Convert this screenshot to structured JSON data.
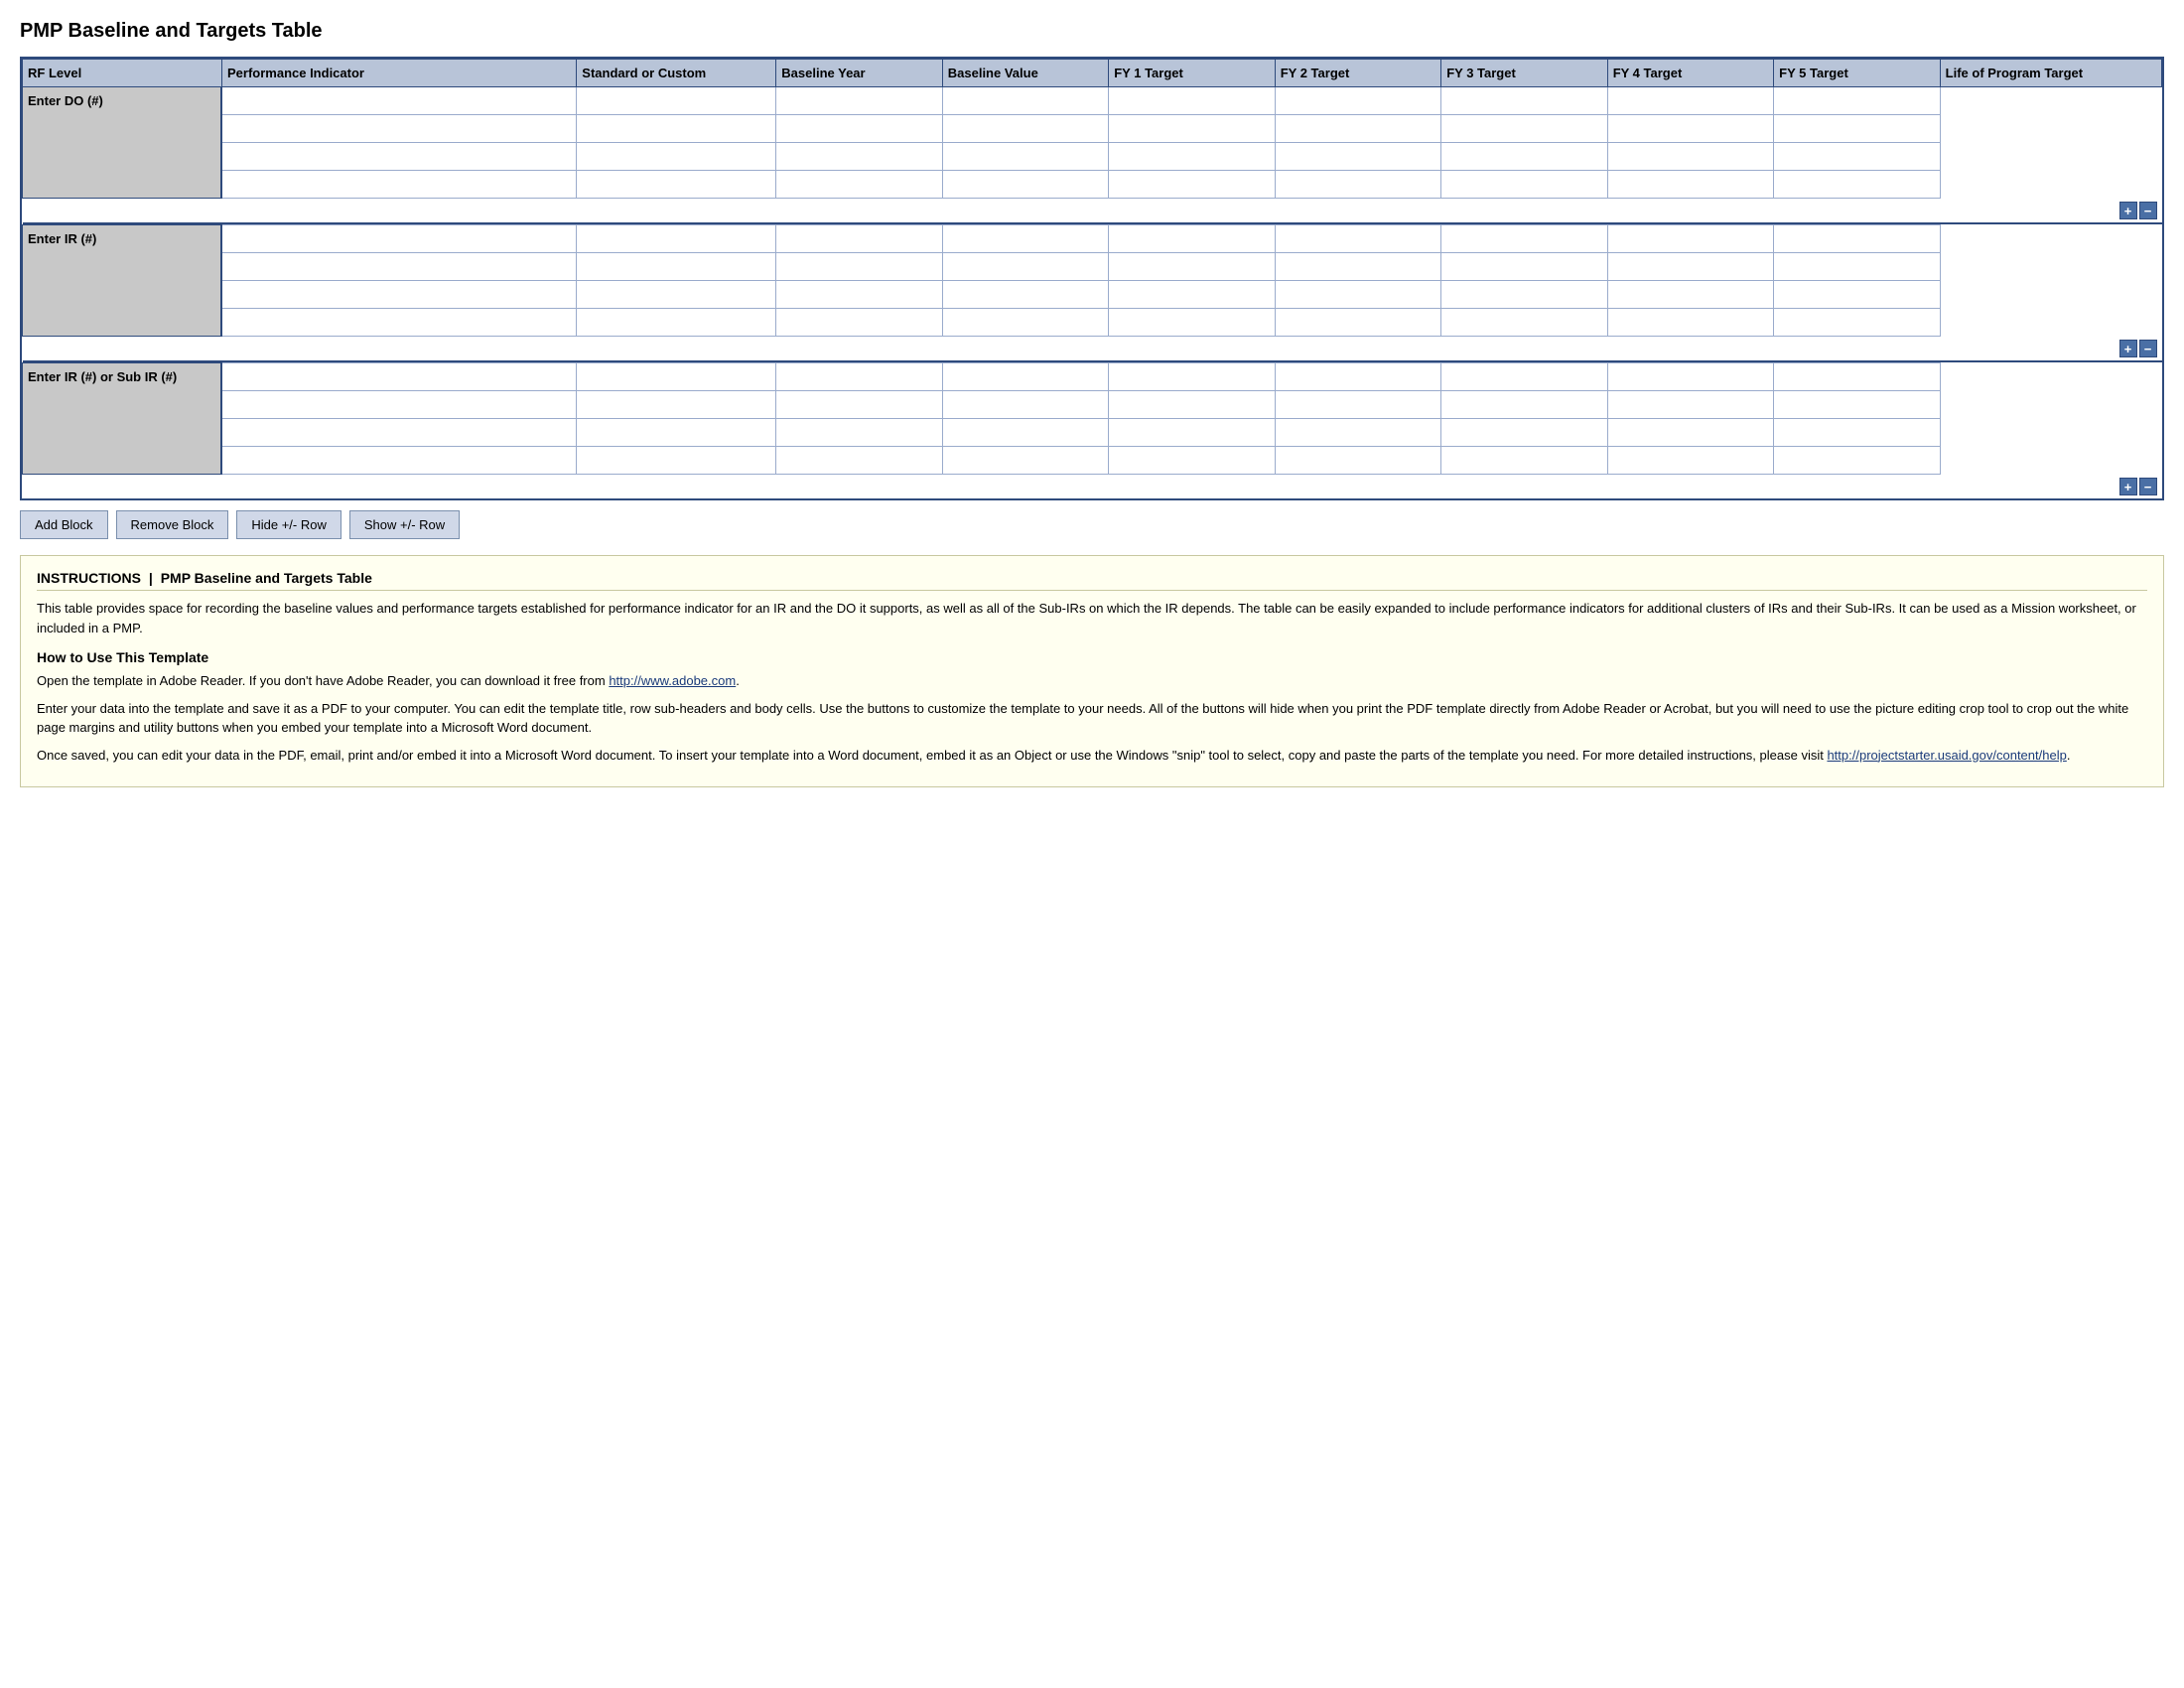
{
  "page": {
    "title": "PMP Baseline and Targets Table"
  },
  "table": {
    "headers": {
      "rf_level": "RF Level",
      "perf_indicator": "Performance Indicator",
      "standard_custom": "Standard or Custom",
      "baseline_year": "Baseline Year",
      "baseline_value": "Baseline Value",
      "fy1": "FY 1 Target",
      "fy2": "FY 2 Target",
      "fy3": "FY 3 Target",
      "fy4": "FY 4 Target",
      "fy5": "FY 5 Target",
      "life_program": "Life of Program Target"
    },
    "blocks": [
      {
        "rf_label": "Enter DO (#)",
        "rows": 4
      },
      {
        "rf_label": "Enter IR (#)",
        "rows": 4
      },
      {
        "rf_label": "Enter IR (#) or Sub IR (#)",
        "rows": 4
      }
    ]
  },
  "toolbar": {
    "add_block": "Add Block",
    "remove_block": "Remove Block",
    "hide_row": "Hide +/- Row",
    "show_row": "Show +/- Row"
  },
  "instructions": {
    "label": "INSTRUCTIONS",
    "title": "PMP Baseline and Targets Table",
    "body": "This table provides space for recording the baseline values and performance targets established for performance indicator for an IR and the DO it supports, as well as all of the Sub-IRs on which the IR depends. The table can be easily expanded to include performance indicators for additional clusters of IRs and their Sub-IRs. It can be used as a Mission worksheet, or included in a PMP.",
    "how_to_title": "How to Use This Template",
    "how_to_p1_before": "Open the template in Adobe Reader. If you don't have Adobe Reader, you can download it free from ",
    "how_to_p1_link": "http://www.adobe.com",
    "how_to_p1_after": ".",
    "how_to_p2": "Enter your data into the template and save it as a PDF to your computer. You can edit the template title, row sub-headers and body cells. Use the buttons to customize the template to your needs. All of the buttons will hide when you print the PDF template directly from Adobe Reader or Acrobat, but you will need to use the picture editing crop tool to crop out the white page margins and utility buttons when you embed your template into a Microsoft Word document.",
    "how_to_p3_before": "Once saved, you can edit your data in the PDF, email, print and/or embed it into a Microsoft Word document. To insert your template into a Word document, embed it as an Object or use the Windows \"snip\" tool to select, copy and paste the parts of the template you need. For more detailed instructions, please visit ",
    "how_to_p3_link": "http://projectstarter.usaid.gov/content/help",
    "how_to_p3_after": "."
  }
}
